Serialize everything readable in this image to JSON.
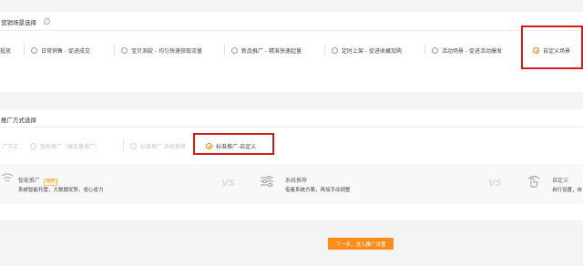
{
  "scene_section": {
    "title": "营销场景选择",
    "options": [
      {
        "label": "投放",
        "selected": false
      },
      {
        "label": "日常销售 - 促进成交",
        "selected": false
      },
      {
        "label": "宝贝测款 - 均匀快速获取流量",
        "selected": false
      },
      {
        "label": "新品推广 - 精准快速起量",
        "selected": false
      },
      {
        "label": "定时上架 - 促进收藏加购",
        "selected": false
      },
      {
        "label": "活动场景 - 促进活动爆发",
        "selected": false
      },
      {
        "label": "自定义场景",
        "selected": true
      }
    ]
  },
  "promo_section": {
    "title": "推广方式选择",
    "options": [
      {
        "label": "广方式",
        "selected": false,
        "disabled": true
      },
      {
        "label": "智能推广（爆品量推广）",
        "selected": false,
        "disabled": true
      },
      {
        "label": "标准推广-系统推荐",
        "selected": false,
        "disabled": true
      },
      {
        "label": "标准推广-自定义",
        "selected": true,
        "disabled": false
      }
    ]
  },
  "comparison": {
    "smart": {
      "title": "智能推广",
      "badge": "推荐",
      "desc": "系统智能托管，大数据优势，省心省力"
    },
    "vs_label": "VS",
    "system": {
      "title": "系统推荐",
      "desc": "借鉴系统方案，再加手动调整"
    },
    "custom": {
      "title": "自定义",
      "desc": "自行设置，自"
    }
  },
  "next_button": {
    "label": "下一步，进入推广设置"
  },
  "colors": {
    "accent": "#ff7a00",
    "highlight": "#d21b1b",
    "button": "#ff8c1a"
  }
}
